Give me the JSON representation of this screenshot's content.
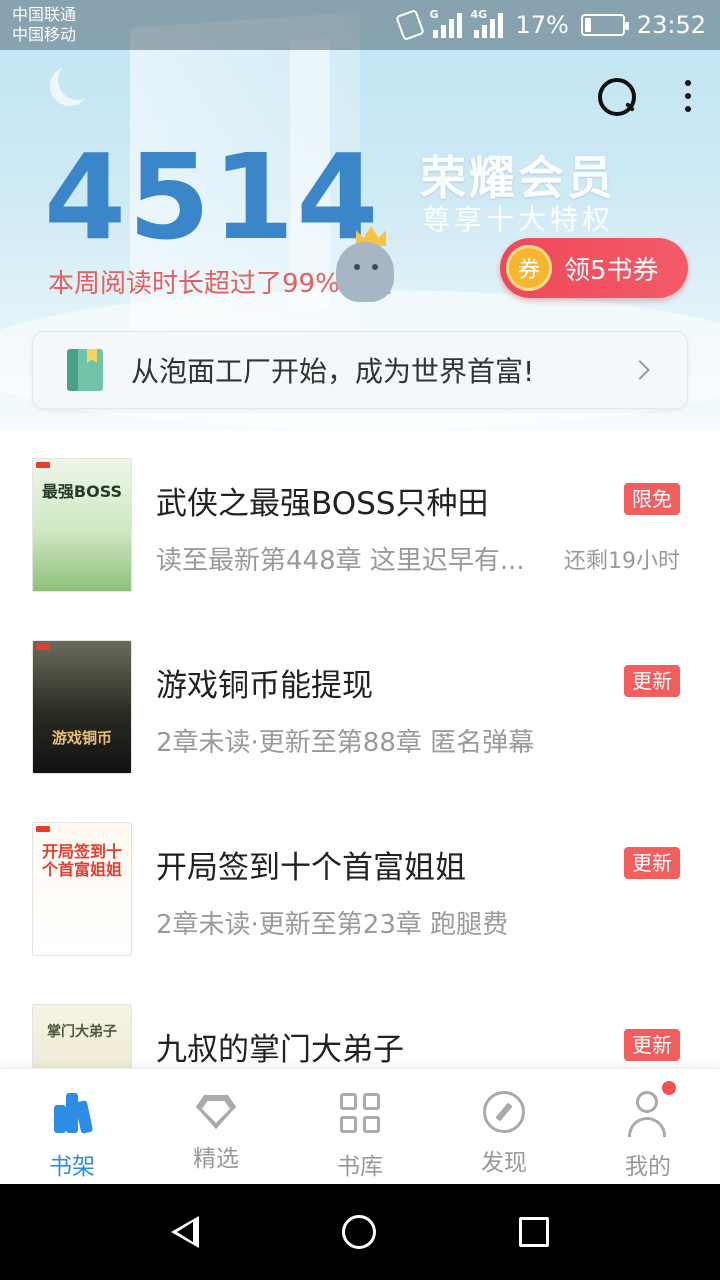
{
  "status_bar": {
    "carrier_1": "中国联通",
    "carrier_2": "中国移动",
    "net_1": "G",
    "net_2": "4G",
    "battery_text": "17%",
    "battery_level": 0.17,
    "time": "23:52"
  },
  "header": {
    "reading_time": "4514",
    "reading_note": "本周阅读时长超过了99%书友",
    "vip_title": "荣耀会员",
    "vip_subtitle": "尊享十大特权",
    "coupon_icon_text": "券",
    "coupon_label": "领5书券",
    "icons": [
      "search-icon",
      "more-icon"
    ]
  },
  "recommendation": {
    "text": "从泡面工厂开始，成为世界首富!"
  },
  "books": [
    {
      "cover_title": "最强BOSS",
      "title": "武侠之最强BOSS只种田",
      "meta": "读至最新第448章 这里迟早有...",
      "remain": "还剩19小时",
      "badge": "限免"
    },
    {
      "cover_title": "游戏铜币",
      "title": "游戏铜币能提现",
      "meta": "2章未读·更新至第88章 匿名弹幕",
      "remain": "",
      "badge": "更新"
    },
    {
      "cover_title": "开局签到十个首富姐姐",
      "title": "开局签到十个首富姐姐",
      "meta": "2章未读·更新至第23章 跑腿费",
      "remain": "",
      "badge": "更新"
    },
    {
      "cover_title": "掌门大弟子",
      "title": "九叔的掌门大弟子",
      "meta": "",
      "remain": "",
      "badge": "更新"
    }
  ],
  "bottom_nav": [
    {
      "label": "书架",
      "icon": "bookshelf-icon",
      "active": true
    },
    {
      "label": "精选",
      "icon": "diamond-icon",
      "active": false
    },
    {
      "label": "书库",
      "icon": "grid-icon",
      "active": false
    },
    {
      "label": "发现",
      "icon": "compass-icon",
      "active": false
    },
    {
      "label": "我的",
      "icon": "user-icon",
      "active": false
    }
  ],
  "colors": {
    "accent": "#2d8ce3",
    "badge": "#f25e5e",
    "reading_number": "#3b86c9",
    "note": "#e3605f"
  }
}
